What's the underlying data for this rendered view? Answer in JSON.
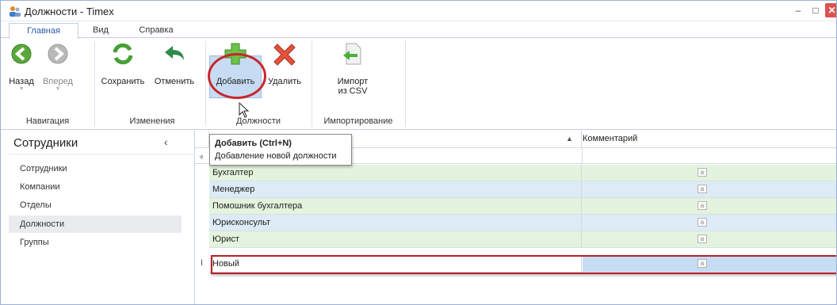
{
  "window": {
    "title": "Должности - Timex",
    "minimize": "‒",
    "maximize": "□",
    "close": "✕"
  },
  "tabs": [
    "Главная",
    "Вид",
    "Справка"
  ],
  "ribbon": {
    "groups": {
      "navigation": "Навигация",
      "changes": "Изменения",
      "positions": "Должности",
      "import": "Импортирование"
    },
    "back": "Назад",
    "forward": "Вперед",
    "save": "Сохранить",
    "cancel": "Отменить",
    "add": "Добавить",
    "delete": "Удалить",
    "import_line1": "Импорт",
    "import_line2": "из CSV"
  },
  "tooltip": {
    "title": "Добавить (Ctrl+N)",
    "description": "Добавление новой должности"
  },
  "nav": {
    "title": "Сотрудники",
    "collapse": "‹",
    "items": [
      "Сотрудники",
      "Компании",
      "Отделы",
      "Должности",
      "Группы"
    ],
    "selected": "Должности"
  },
  "grid": {
    "columns": {
      "comment": "Комментарий"
    },
    "sort_arrow": "▲",
    "filter_icon": "ᵩ",
    "rows": [
      "Бухгалтер",
      "Менеджер",
      "Помошник бухгалтера",
      "Юрисконсульт",
      "Юрист"
    ],
    "memo_icon": "a",
    "new_row": {
      "indicator": "I",
      "value": "Новый"
    }
  },
  "colors": {
    "highlight": "#c8262b",
    "green_row": "#e3f3dd",
    "blue_row": "#dcebf6"
  }
}
